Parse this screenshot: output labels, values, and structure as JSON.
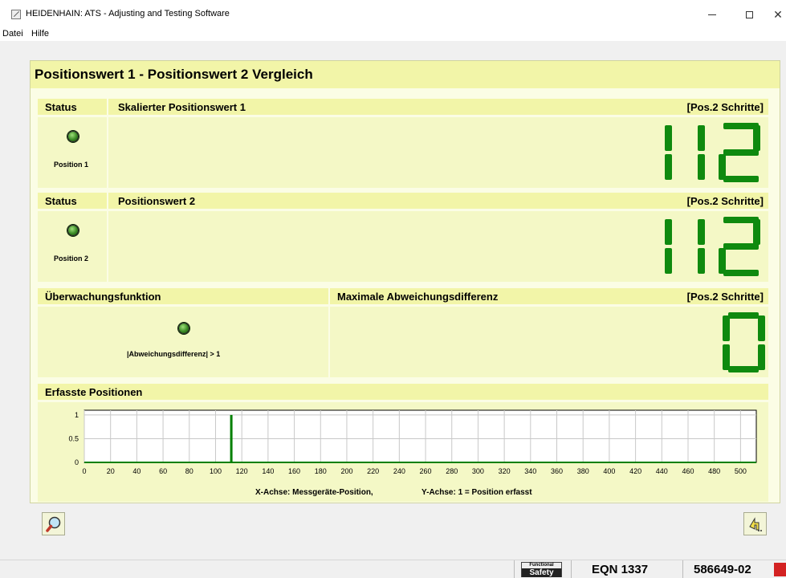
{
  "window": {
    "title": "HEIDENHAIN: ATS - Adjusting and Testing Software",
    "minimize_glyph": "—",
    "close_glyph": "✕"
  },
  "menu": {
    "items": [
      "Datei",
      "Hilfe"
    ]
  },
  "panel": {
    "title": "Positionswert 1 - Positionswert 2 Vergleich",
    "section1": {
      "status_header": "Status",
      "value_header": "Skalierter Positionswert 1",
      "unit": "[Pos.2 Schritte]",
      "led_label": "Position 1",
      "value": "112",
      "led_color": "#3a8a25"
    },
    "section2": {
      "status_header": "Status",
      "value_header": "Positionswert 2",
      "unit": "[Pos.2 Schritte]",
      "led_label": "Position 2",
      "value": "112"
    },
    "section3": {
      "monitor_header": "Überwachungsfunktion",
      "maxdiff_header": "Maximale Abweichungsdifferenz",
      "unit": "[Pos.2 Schritte]",
      "led_label": "|Abweichungsdifferenz| > 1",
      "value": "0"
    },
    "section4": {
      "header": "Erfasste Positionen",
      "x_caption": "X-Achse: Messgeräte-Position,",
      "y_caption": "Y-Achse: 1 = Position erfasst"
    }
  },
  "chart_data": {
    "type": "bar",
    "title": "",
    "xlabel": "X-Achse: Messgeräte-Position,",
    "ylabel": "Y-Achse: 1 = Position erfasst",
    "xlim": [
      0,
      512
    ],
    "ylim": [
      0,
      1.1
    ],
    "x_ticks": [
      0,
      20,
      40,
      60,
      80,
      100,
      120,
      140,
      160,
      180,
      200,
      220,
      240,
      260,
      280,
      300,
      320,
      340,
      360,
      380,
      400,
      420,
      440,
      460,
      480,
      500
    ],
    "y_ticks": [
      0,
      0.5,
      1
    ],
    "y_tick_labels": [
      "0",
      "0.5",
      "1"
    ],
    "grid": true,
    "series": [
      {
        "x": [
          112
        ],
        "values": [
          1
        ],
        "color": "#008000"
      }
    ]
  },
  "colors": {
    "digit": "#0f8a0f",
    "header_bg": "#f2f5a8",
    "body_bg": "#f4f8c6"
  },
  "icons": {
    "search_button": "magnifier-icon",
    "exit_button": "exit-icon"
  },
  "statusbar": {
    "badge_top": "Functional",
    "badge_bottom": "Safety",
    "device": "EQN 1337",
    "id": "586649-02"
  }
}
